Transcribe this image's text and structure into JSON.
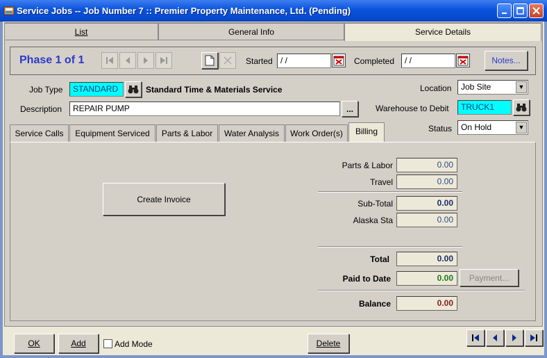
{
  "window": {
    "title": "Service Jobs -- Job Number 7 :: Premier Property Maintenance, Ltd.      (Pending)"
  },
  "top_tabs": [
    {
      "label": "List"
    },
    {
      "label": "General Info"
    },
    {
      "label": "Service Details"
    }
  ],
  "phase": {
    "label": "Phase 1 of  1",
    "started_label": "Started",
    "started_value": " / /",
    "completed_label": "Completed",
    "completed_value": " / /",
    "notes_label": "Notes..."
  },
  "job": {
    "job_type_label": "Job Type",
    "job_type_value": "STANDARD",
    "job_type_desc": "Standard Time & Materials Service",
    "description_label": "Description",
    "description_value": "REPAIR PUMP",
    "ellipsis": "...",
    "location_label": "Location",
    "location_value": "Job Site",
    "warehouse_label": "Warehouse to Debit",
    "warehouse_value": "TRUCK1",
    "status_label": "Status",
    "status_value": "On Hold"
  },
  "sub_tabs": [
    {
      "label": "Service Calls"
    },
    {
      "label": "Equipment Serviced"
    },
    {
      "label": "Parts & Labor"
    },
    {
      "label": "Water Analysis"
    },
    {
      "label": "Work Order(s)"
    },
    {
      "label": "Billing"
    }
  ],
  "billing": {
    "create_invoice_label": "Create Invoice",
    "parts_labor_label": "Parts & Labor",
    "parts_labor_value": "0.00",
    "travel_label": "Travel",
    "travel_value": "0.00",
    "subtotal_label": "Sub-Total",
    "subtotal_value": "0.00",
    "tax_label": "Alaska Sta",
    "tax_value": "0.00",
    "total_label": "Total",
    "total_value": "0.00",
    "paid_label": "Paid to Date",
    "paid_value": "0.00",
    "payment_label": "Payment...",
    "balance_label": "Balance",
    "balance_value": "0.00",
    "colors": {
      "total": "#1a2c6a",
      "paid": "#1a7a1a",
      "balance": "#8a1a1a"
    }
  },
  "bottom": {
    "ok_label": "OK",
    "add_label": "Add",
    "add_mode_label": "Add Mode",
    "delete_label": "Delete"
  },
  "icons": [
    "app-icon",
    "minimize-icon",
    "maximize-icon",
    "close-icon",
    "first-icon",
    "previous-icon",
    "next-icon",
    "last-icon",
    "new-document-icon",
    "delete-x-icon",
    "calendar-icon",
    "binoculars-icon",
    "dropdown-arrow-icon"
  ]
}
